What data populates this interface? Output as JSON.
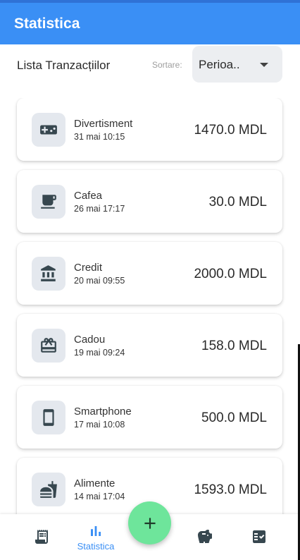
{
  "appbar": {
    "title": "Statistica"
  },
  "header": {
    "list_title": "Lista Tranzacțiilor",
    "sort_label": "Sortare:",
    "sort_value": "Perioa.."
  },
  "transactions": [
    {
      "name": "Divertisment",
      "date": "31 mai 10:15",
      "amount": "1470.0 MDL",
      "icon": "gamepad-icon"
    },
    {
      "name": "Cafea",
      "date": "26 mai 17:17",
      "amount": "30.0 MDL",
      "icon": "coffee-icon"
    },
    {
      "name": "Credit",
      "date": "20 mai 09:55",
      "amount": "2000.0 MDL",
      "icon": "bank-icon"
    },
    {
      "name": "Cadou",
      "date": "19 mai 09:24",
      "amount": "158.0 MDL",
      "icon": "gift-card-icon"
    },
    {
      "name": "Smartphone",
      "date": "17 mai 10:08",
      "amount": "500.0 MDL",
      "icon": "smartphone-icon"
    },
    {
      "name": "Alimente",
      "date": "14 mai 17:04",
      "amount": "1593.0 MDL",
      "icon": "fastfood-icon"
    }
  ],
  "bottom_nav": {
    "items": [
      {
        "icon": "receipt-icon",
        "label": ""
      },
      {
        "icon": "bar-chart-icon",
        "label": "Statistica"
      },
      {
        "icon": "piggy-bank-icon",
        "label": ""
      },
      {
        "icon": "checklist-icon",
        "label": ""
      }
    ],
    "fab_icon": "plus-icon"
  },
  "colors": {
    "appbar": "#3a8ff5",
    "fab": "#6ee59b",
    "icon_box": "#e4e8ee",
    "active_nav": "#3a8ff5",
    "icon": "#37474f"
  }
}
